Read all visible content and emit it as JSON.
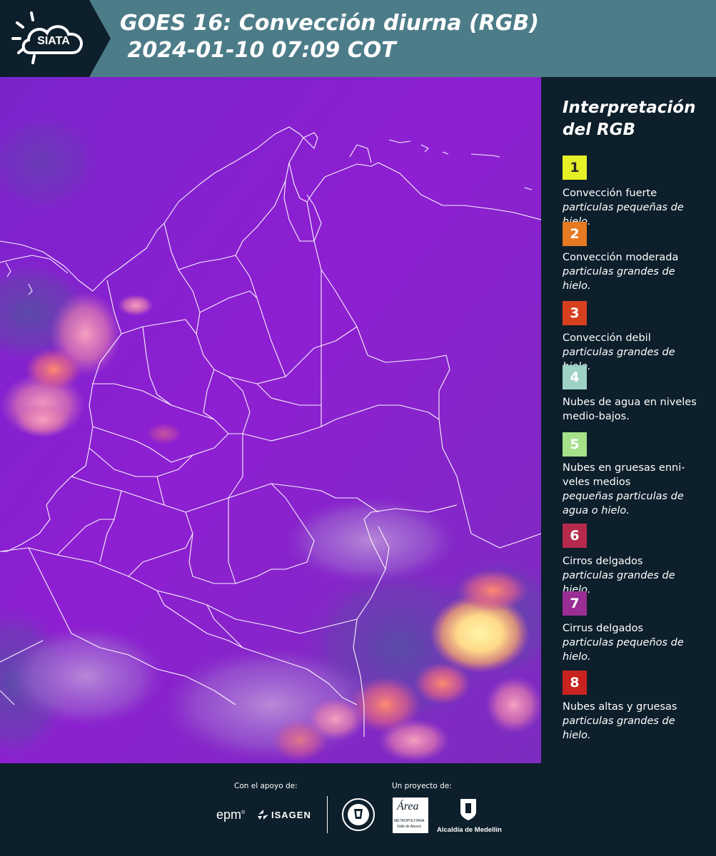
{
  "header": {
    "logo_text": "SIATA",
    "title_line1": "GOES 16: Convección diurna (RGB)",
    "title_line2": " 2024-01-10 07:09 COT"
  },
  "legend": {
    "title": "Interpretación\ndel RGB",
    "items": [
      {
        "num": "1",
        "color": "#e6f026",
        "num_color": "#2a2a2a",
        "label": "Convección fuerte",
        "sub": "particulas pequeñas de hielo."
      },
      {
        "num": "2",
        "color": "#e67a22",
        "num_color": "#ffffff",
        "label": "Convección moderada",
        "sub": "particulas grandes de hielo."
      },
      {
        "num": "3",
        "color": "#d6401e",
        "num_color": "#ffffff",
        "label": "Convección debil",
        "sub": "particulas grandes de hielo."
      },
      {
        "num": "4",
        "color": "#9fd2c6",
        "num_color": "#ffffff",
        "label": "Nubes de agua en niveles medio-bajos.",
        "sub": ""
      },
      {
        "num": "5",
        "color": "#a6e28a",
        "num_color": "#ffffff",
        "label": "Nubes en gruesas enni-veles medios",
        "sub": "pequeñas particulas de agua o hielo."
      },
      {
        "num": "6",
        "color": "#b52a4c",
        "num_color": "#ffffff",
        "label": "Cirros delgados",
        "sub": "particulas grandes de hielo."
      },
      {
        "num": "7",
        "color": "#9a2e94",
        "num_color": "#ffffff",
        "label": "Cirrus delgados",
        "sub": "particulas pequeños de hielo."
      },
      {
        "num": "8",
        "color": "#c8231e",
        "num_color": "#ffffff",
        "label": "Nubes altas y gruesas",
        "sub": "particulas grandes de hielo."
      }
    ]
  },
  "footer": {
    "support_label": "Con el apoyo de:",
    "project_label": "Un proyecto de:",
    "sponsor1": "epm",
    "sponsor2": "ISAGEN",
    "partner1": "Área",
    "partner1_sub": "METROPOLITANA",
    "partner1_sub2": "Valle de Aburrá",
    "partner2": "Alcaldía de Medellín"
  },
  "colors": {
    "header_bg": "#4d7c89",
    "logo_bg": "#0d1f2b",
    "page_bg": "#0d1f2b",
    "map_base": "#8a1fd0",
    "border_lines": "#ffffff"
  }
}
